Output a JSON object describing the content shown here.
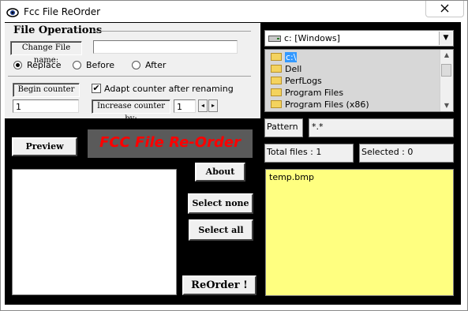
{
  "window": {
    "title": "Fcc File ReOrder",
    "close_glyph": "✕"
  },
  "file_operations": {
    "title": "File Operations",
    "change_file_name_label": "Change File name:",
    "change_file_name_value": "",
    "radio_options": [
      {
        "label": "Replace",
        "selected": true
      },
      {
        "label": "Before",
        "selected": false
      },
      {
        "label": "After",
        "selected": false
      }
    ],
    "begin_counter_label": "Begin counter",
    "begin_counter_value": "1",
    "adapt_counter_label": "Adapt counter after renaming",
    "adapt_counter_checked": true,
    "check_glyph": "✔",
    "increase_counter_label": "Increase counter by:",
    "increase_counter_value": "1",
    "spin_left_glyph": "◂",
    "spin_right_glyph": "▸"
  },
  "buttons": {
    "preview": "Preview",
    "about": "About",
    "select_none": "Select none",
    "select_all": "Select all",
    "reorder": "ReOrder !"
  },
  "banner": "FCC File Re-Order",
  "drive": {
    "value": "c: [Windows]",
    "arrow_glyph": "▼"
  },
  "folders": {
    "items": [
      "c:\\",
      "Dell",
      "PerfLogs",
      "Program Files",
      "Program Files (x86)"
    ],
    "selected_index": 0,
    "scroll_up_glyph": "▲",
    "scroll_down_glyph": "▼"
  },
  "pattern": {
    "label": "Pattern :",
    "value": "*.*"
  },
  "totals": {
    "total_files": "Total files : 1",
    "selected": "Selected : 0"
  },
  "file_list": [
    "temp.bmp"
  ],
  "colors": {
    "background": "#000000",
    "file_list_bg": "#ffff80",
    "banner_text": "#ff0000",
    "selection": "#3399ff"
  }
}
